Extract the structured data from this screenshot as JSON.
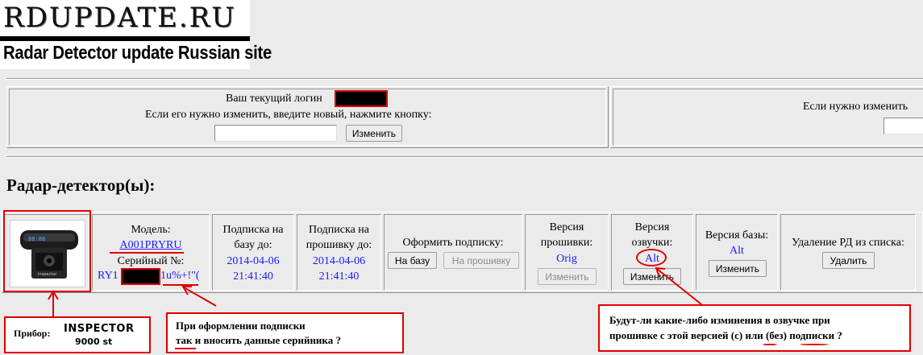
{
  "logo": {
    "title": "RDUPDATE.RU",
    "subtitle": "Radar Detector update Russian site"
  },
  "login": {
    "current_login_label": "Ваш текущий логин",
    "change_hint": "Если его нужно изменить, введите новый, нажмите кнопку:",
    "input_value": "",
    "change_button": "Изменить"
  },
  "password": {
    "change_hint": "Если нужно изменить"
  },
  "devices_heading": "Радар-детектор(ы):",
  "device": {
    "model_label": "Модель:",
    "model_value": "A001PRYRU",
    "serial_label": "Серийный №:",
    "serial_prefix": "RY1",
    "serial_suffix": "1u%+!\"(",
    "db_sub_label_1": "Подписка на",
    "db_sub_label_2": "базу до:",
    "db_sub_date": "2014-04-06",
    "db_sub_time": "21:41:40",
    "fw_sub_label_1": "Подписка на",
    "fw_sub_label_2": "прошивку до:",
    "fw_sub_date": "2014-04-06",
    "fw_sub_time": "21:41:40",
    "order_label": "Оформить подписку:",
    "order_db_button": "На базу",
    "order_fw_button": "На прошивку",
    "fw_version_label_1": "Версия",
    "fw_version_label_2": "прошивки:",
    "fw_version_value": "Orig",
    "fw_change_button": "Изменить",
    "voice_version_label_1": "Версия",
    "voice_version_label_2": "озвучки:",
    "voice_version_value": "Alt",
    "voice_change_button": "Изменить",
    "db_version_label": "Версия базы:",
    "db_version_value": "Alt",
    "db_change_button": "Изменить",
    "remove_label": "Удаление РД из списка:",
    "remove_button": "Удалить"
  },
  "annotations": {
    "device_label": "Прибор:",
    "device_name_1": "INSPECTOR",
    "device_name_2": "9000 st",
    "serial_note_1": "При оформлении подписки",
    "serial_note_2": "так и вносить данные серийника ?",
    "voice_note_1": "Будут-ли какие-либо изминения в озвучке при",
    "voice_note_2": "прошивке с этой версией (с) или (без) подписки ?"
  },
  "colors": {
    "page_bg": "#ebebeb",
    "link": "#1a1aff",
    "annotation_red": "#e00000"
  }
}
